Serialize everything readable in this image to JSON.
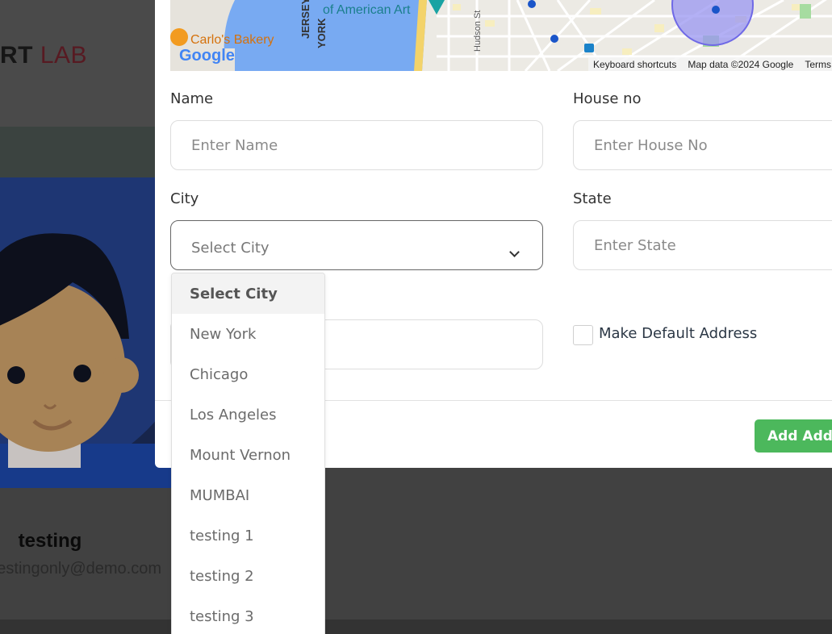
{
  "background": {
    "logo_bold": "RT",
    "logo_light": "LAB",
    "user_name": "testing",
    "user_email": "testingonly@demo.com"
  },
  "map": {
    "labels": {
      "museum": "of American Art",
      "bakery": "Carlo's Bakery",
      "google": "Google",
      "jersey": "JERSEY",
      "york": "YORK",
      "hudson": "Hudson St"
    },
    "footer": {
      "shortcuts": "Keyboard shortcuts",
      "map_data": "Map data ©2024 Google",
      "terms": "Terms"
    }
  },
  "form": {
    "name": {
      "label": "Name",
      "placeholder": "Enter Name"
    },
    "house": {
      "label": "House no",
      "placeholder": "Enter House No"
    },
    "city": {
      "label": "City",
      "selected": "Select City"
    },
    "state": {
      "label": "State",
      "placeholder": "Enter State"
    },
    "default_address_label": "Make Default Address",
    "submit_label": "Add Address"
  },
  "city_dropdown": {
    "options": [
      "Select City",
      "New York",
      "Chicago",
      "Los Angeles",
      "Mount Vernon",
      "MUMBAI",
      "testing 1",
      "testing 2",
      "testing 3"
    ]
  },
  "colors": {
    "accent_green": "#4cb85c",
    "logo_dark": "#571a22"
  }
}
